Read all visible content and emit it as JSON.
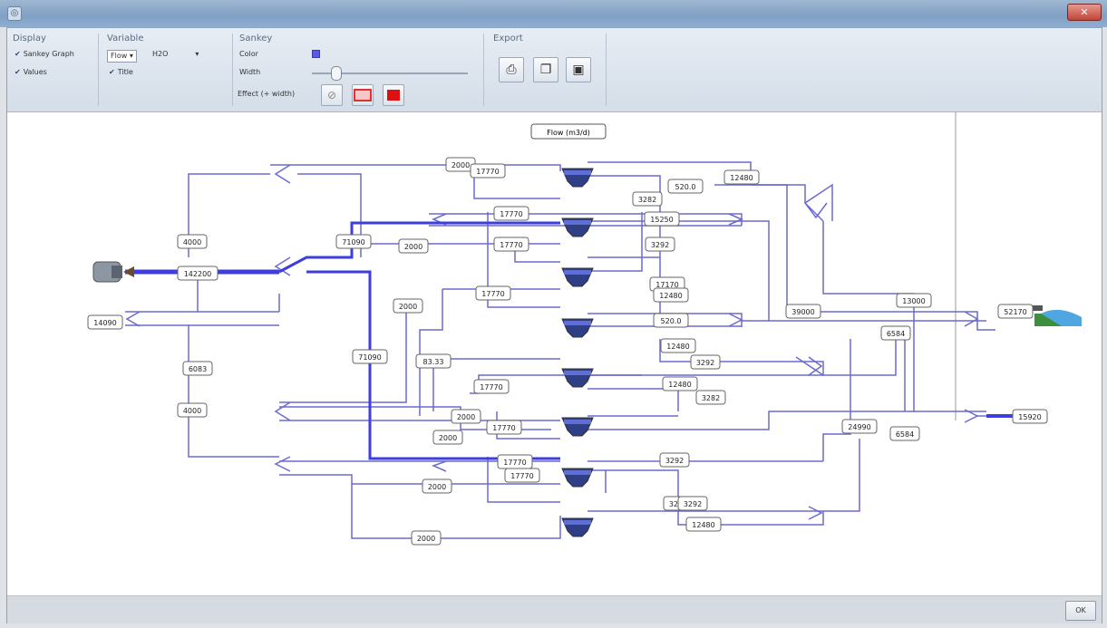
{
  "window": {
    "title": "",
    "ok_label": "OK"
  },
  "toolbar": {
    "display": {
      "title": "Display",
      "sankey_graph": "Sankey Graph",
      "values": "Values"
    },
    "variable": {
      "title": "Variable",
      "selected": "Flow",
      "secondary": "H2O",
      "title_option": "Title"
    },
    "sankey": {
      "title": "Sankey",
      "color_label": "Color",
      "width_label": "Width",
      "effect_label": "Effect (+ width)",
      "color": "#5a5ae6",
      "width_level": 0.12
    },
    "export": {
      "title": "Export",
      "buttons": [
        "print-icon",
        "copy-icon",
        "save-icon"
      ]
    }
  },
  "diagram": {
    "title": "Flow (m3/d)",
    "line_color": "#6a6ad0",
    "highlight_color": "#3e3ee0",
    "labels": [
      "2000",
      "17770",
      "12480",
      "520.0",
      "3282",
      "17770",
      "15250",
      "4000",
      "71090",
      "2000",
      "17770",
      "3292",
      "142200",
      "17170",
      "12480",
      "2000",
      "17770",
      "13000",
      "14090",
      "520.0",
      "39000",
      "6584",
      "52170",
      "71090",
      "83.33",
      "12480",
      "3292",
      "6083",
      "17770",
      "12480",
      "3282",
      "4000",
      "2000",
      "17770",
      "24990",
      "15920",
      "2000",
      "6584",
      "17770",
      "3292",
      "2000",
      "17770",
      "3292",
      "3292",
      "12480",
      "2000"
    ]
  }
}
